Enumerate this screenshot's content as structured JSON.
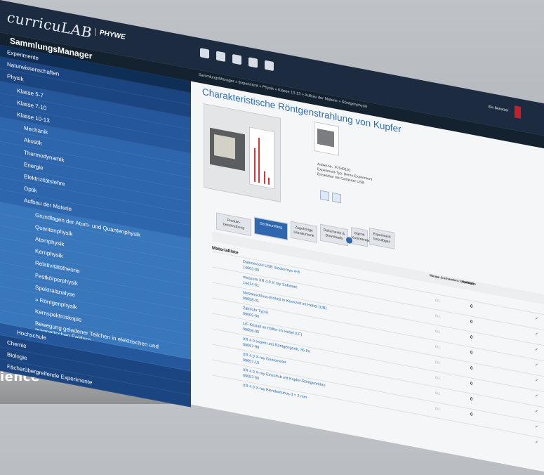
{
  "header": {
    "logo": "curricuLAB",
    "brand": "PHYWE",
    "user": "Ein Benutzer",
    "icons": [
      "sitemap-icon",
      "calculator-icon",
      "cabinet-icon",
      "gear-icon",
      "mail-icon"
    ]
  },
  "subheader": {
    "app_name": "SammlungsManager",
    "breadcrumb": "SammlungsManager  »  Experiment  »  Physik  »  Klasse 10-13  »  Aufbau der Materie  »  Röntgenphysik"
  },
  "sidebar": {
    "items": [
      {
        "label": "Experimente",
        "level": 0,
        "selected": true
      },
      {
        "label": "Naturwissenschaften",
        "level": 0
      },
      {
        "label": "Physik",
        "level": 0
      },
      {
        "label": "Klasse 5-7",
        "level": 1
      },
      {
        "label": "Klasse 7-10",
        "level": 1
      },
      {
        "label": "Klasse 10-13",
        "level": 1
      },
      {
        "label": "Mechanik",
        "level": 2
      },
      {
        "label": "Akustik",
        "level": 2
      },
      {
        "label": "Thermodynamik",
        "level": 2
      },
      {
        "label": "Energie",
        "level": 2
      },
      {
        "label": "Elektrizitätslehre",
        "level": 2
      },
      {
        "label": "Optik",
        "level": 2
      },
      {
        "label": "Aufbau der Materie",
        "level": 2
      },
      {
        "label": "Grundlagen der Atom- und Quantenphysik",
        "level": 3
      },
      {
        "label": "Quantenphysik",
        "level": 3
      },
      {
        "label": "Atomphysik",
        "level": 3
      },
      {
        "label": "Kernphysik",
        "level": 3
      },
      {
        "label": "Relativitätstheorie",
        "level": 3
      },
      {
        "label": "Festkörperphysik",
        "level": 3
      },
      {
        "label": "Spektralanalyse",
        "level": 3
      },
      {
        "label": "» Röntgenphysik",
        "level": 3
      },
      {
        "label": "Kernspektroskopie",
        "level": 3
      },
      {
        "label": "Bewegung geladener Teilchen in elektrischen und magnetischen Feldern",
        "level": 3
      },
      {
        "label": "Hochschule",
        "level": 1
      },
      {
        "label": "Chemie",
        "level": 0
      },
      {
        "label": "Biologie",
        "level": 0
      },
      {
        "label": "Fächerübergreifende Experimente",
        "level": 0
      }
    ]
  },
  "main": {
    "title": "Charakteristische Röntgenstrahlung von Kupfer",
    "meta": {
      "line1": "Artikel-Nr.: P2540101",
      "line2": "Experiment-Typ: Demo-Experiment",
      "line3": "Einsetzbar mit Computer USB"
    },
    "tabs": [
      {
        "label": "Produkt-\nbeschreibung",
        "active": false
      },
      {
        "label": "Geräteumfang",
        "active": true
      },
      {
        "label": "Zugehörige\nLiteraturserie",
        "active": false
      },
      {
        "label": "Dokumente &\nDownloads",
        "active": false
      },
      {
        "label": "eigene\nKommentare",
        "active": false
      },
      {
        "label": "Experiment\nhinzufügen",
        "active": false
      }
    ],
    "table": {
      "col_qty": "Menge\n(vorhanden / benötigt)",
      "col_status": "Optionen",
      "section": "Materialliste",
      "rows": [
        {
          "name": "Datenmodul USB Steckersys 4-B",
          "nr": "14602-00",
          "status": "0/1",
          "qty": "0"
        },
        {
          "name": "measure XR 4.0 X-ray Software",
          "nr": "14414-61",
          "status": "0/1",
          "qty": "0"
        },
        {
          "name": "Netzanschluss-Einheit in Kennzeit im Hebel (UB)",
          "nr": "09058-01",
          "status": "0/1",
          "qty": "0"
        },
        {
          "name": "Zählrohr Typ B",
          "nr": "09005-00",
          "status": "0/1",
          "qty": "0"
        },
        {
          "name": "LiF-Kristall im Halter im Hebel (LF)",
          "nr": "09056-05",
          "status": "0/1",
          "qty": "0"
        },
        {
          "name": "XR 4.0 expert unit Röntgengerät, 35 kV",
          "nr": "09057-99",
          "status": "0/1",
          "qty": "0"
        },
        {
          "name": "XR 4.0 X-ray Goniometer",
          "nr": "09057-10",
          "status": "0/1",
          "qty": "0"
        },
        {
          "name": "XR 4.0 X-ray Einschub mit Kupfer-Röntgenröhre",
          "nr": "09057-50",
          "status": "0/1",
          "qty": "0"
        },
        {
          "name": "XR 4.0 X-ray Blendentubus d = 2 mm",
          "nr": "",
          "status": "",
          "qty": ""
        }
      ]
    }
  },
  "tagline": "ience",
  "colors": {
    "topbar": "#1c2b3f",
    "sidebar": "#1e4c8c",
    "accent": "#2c6fb3",
    "badge": "#c8202a"
  }
}
